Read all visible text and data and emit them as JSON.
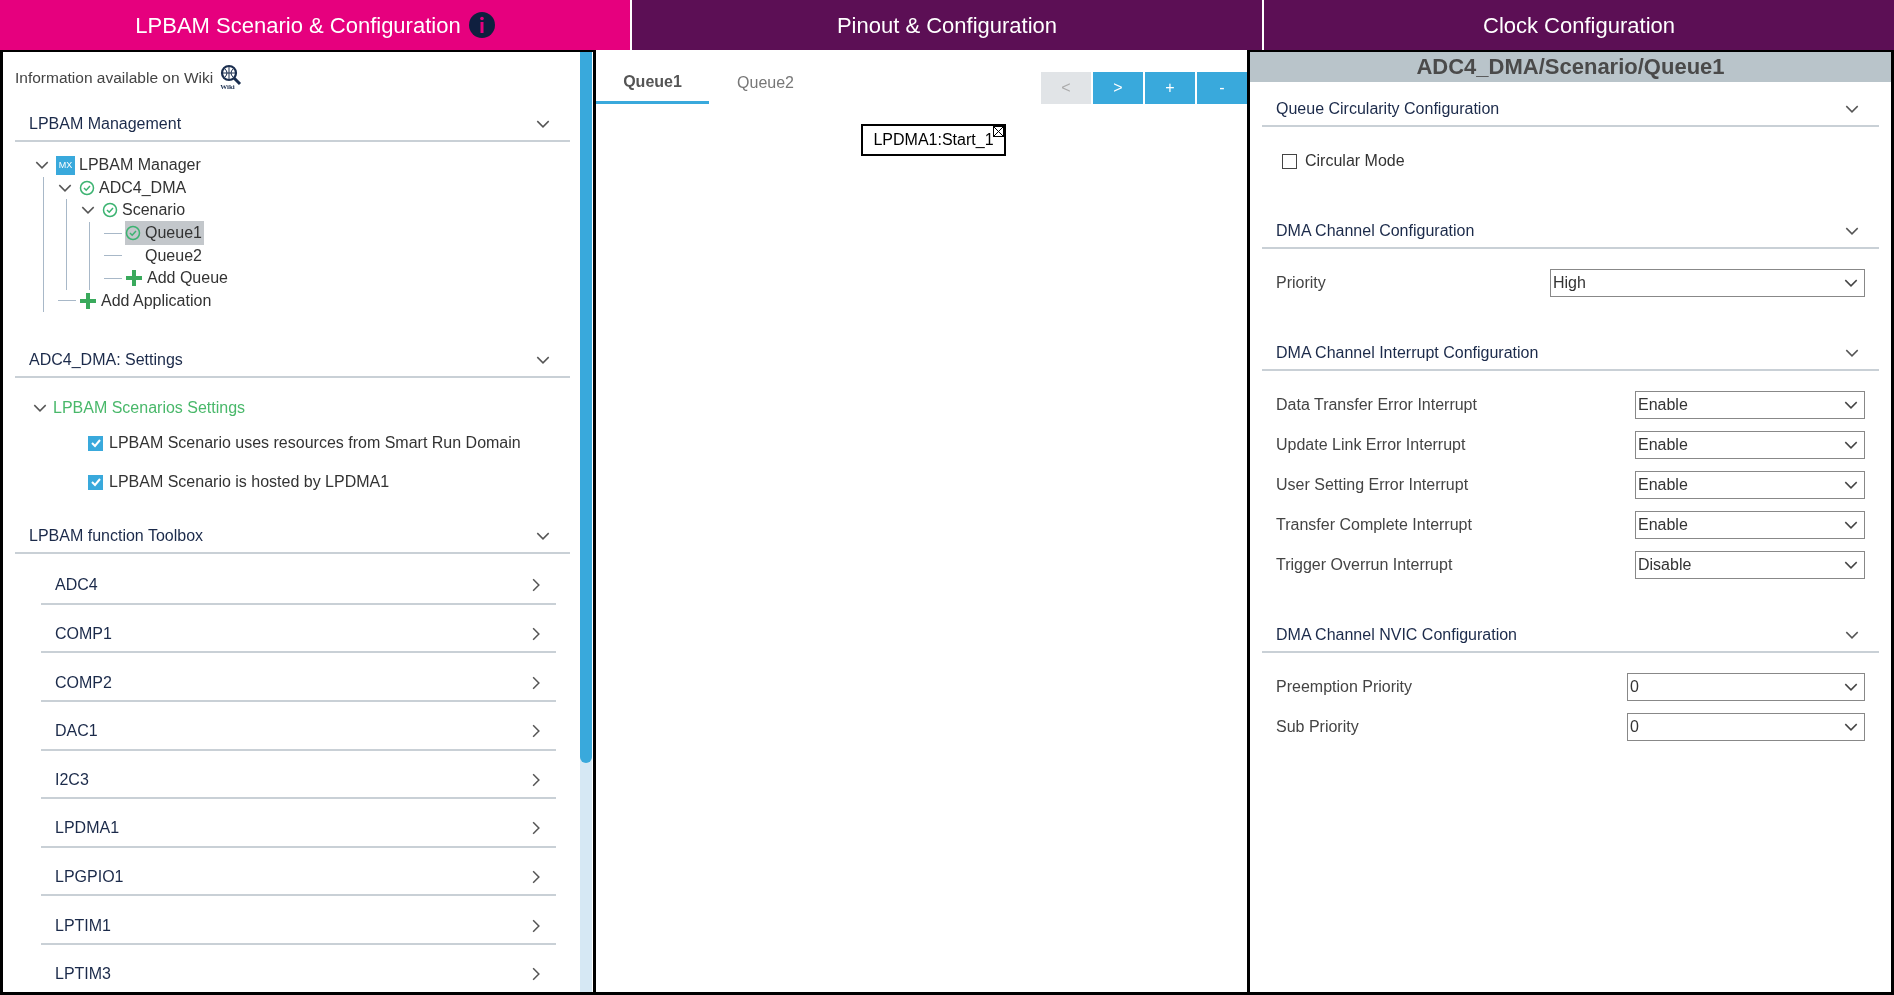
{
  "top_tabs": [
    {
      "label": "LPBAM Scenario & Configuration",
      "selected": true,
      "info": true
    },
    {
      "label": "Pinout & Configuration",
      "selected": false,
      "info": false
    },
    {
      "label": "Clock Configuration",
      "selected": false,
      "info": false
    }
  ],
  "left": {
    "wiki_text": "Information available on Wiki",
    "wiki_badge": "Wiki",
    "management": {
      "title": "LPBAM Management",
      "tree": [
        {
          "label": "LPBAM Manager",
          "kind": "mx",
          "badge": "MX",
          "expanded": true,
          "selected": false,
          "children": [
            {
              "label": "ADC4_DMA",
              "kind": "check",
              "expanded": true,
              "selected": false,
              "children": [
                {
                  "label": "Scenario",
                  "kind": "check",
                  "expanded": true,
                  "selected": false,
                  "children": [
                    {
                      "label": "Queue1",
                      "kind": "check",
                      "selected": true
                    },
                    {
                      "label": "Queue2",
                      "kind": "plain",
                      "selected": false
                    },
                    {
                      "label": "Add Queue",
                      "kind": "add",
                      "selected": false
                    }
                  ]
                }
              ]
            },
            {
              "label": "Add Application",
              "kind": "add",
              "selected": false
            }
          ]
        }
      ]
    },
    "settings": {
      "title": "ADC4_DMA: Settings",
      "group": "LPBAM Scenarios Settings",
      "group_expanded": true,
      "options": [
        {
          "label": "LPBAM Scenario uses resources from Smart Run Domain",
          "checked": true
        },
        {
          "label": "LPBAM Scenario is hosted by LPDMA1",
          "checked": true
        }
      ]
    },
    "toolbox": {
      "title": "LPBAM function Toolbox",
      "items": [
        "ADC4",
        "COMP1",
        "COMP2",
        "DAC1",
        "I2C3",
        "LPDMA1",
        "LPGPIO1",
        "LPTIM1",
        "LPTIM3"
      ]
    }
  },
  "center": {
    "tabs": [
      {
        "label": "Queue1",
        "selected": true
      },
      {
        "label": "Queue2",
        "selected": false
      }
    ],
    "buttons": [
      {
        "label": "<",
        "disabled": true
      },
      {
        "label": ">",
        "disabled": false
      },
      {
        "label": "+",
        "disabled": false
      },
      {
        "label": "-",
        "disabled": false
      }
    ],
    "node": "LPDMA1:Start_1"
  },
  "right": {
    "title": "ADC4_DMA/Scenario/Queue1",
    "sections": [
      {
        "title": "Queue Circularity Configuration",
        "items": [
          {
            "kind": "checkbox",
            "label": "Circular Mode",
            "checked": false
          }
        ]
      },
      {
        "title": "DMA Channel Configuration",
        "items": [
          {
            "kind": "select",
            "label": "Priority",
            "value": "High"
          }
        ]
      },
      {
        "title": "DMA Channel Interrupt Configuration",
        "items": [
          {
            "kind": "select",
            "label": "Data Transfer Error Interrupt",
            "value": "Enable"
          },
          {
            "kind": "select",
            "label": "Update Link Error Interrupt",
            "value": "Enable"
          },
          {
            "kind": "select",
            "label": "User Setting Error Interrupt",
            "value": "Enable"
          },
          {
            "kind": "select",
            "label": "Transfer Complete Interrupt",
            "value": "Enable"
          },
          {
            "kind": "select",
            "label": "Trigger Overrun Interrupt",
            "value": "Disable"
          }
        ]
      },
      {
        "title": "DMA Channel NVIC Configuration",
        "items": [
          {
            "kind": "select",
            "label": "Preemption Priority",
            "value": "0"
          },
          {
            "kind": "select",
            "label": "Sub Priority",
            "value": "0"
          }
        ]
      }
    ]
  }
}
